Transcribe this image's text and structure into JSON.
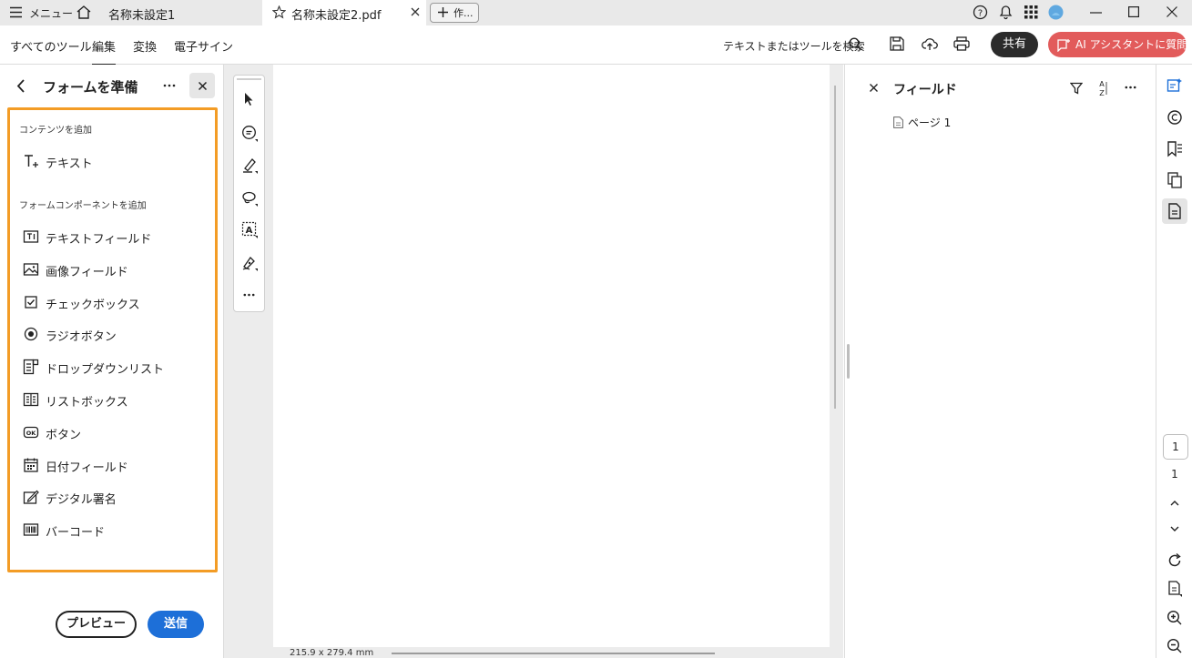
{
  "titlebar": {
    "menu_label": "メニュー",
    "tab1_label": "名称未設定1",
    "tab2_label": "名称未設定2.pdf",
    "new_tab_label": "作..."
  },
  "toolbar": {
    "menu": [
      "すべてのツール",
      "編集",
      "変換",
      "電子サイン"
    ],
    "active_menu": "編集",
    "search_label": "テキストまたはツールを検索",
    "share_label": "共有",
    "ai_label": "AI アシスタントに質問"
  },
  "left_panel": {
    "title": "フォームを準備",
    "section1": "コンテンツを追加",
    "section1_items": [
      {
        "label": "テキスト",
        "icon": "add-text-icon"
      }
    ],
    "section2": "フォームコンポーネントを追加",
    "section2_items": [
      {
        "label": "テキストフィールド",
        "icon": "text-field-icon"
      },
      {
        "label": "画像フィールド",
        "icon": "image-field-icon"
      },
      {
        "label": "チェックボックス",
        "icon": "checkbox-icon"
      },
      {
        "label": "ラジオボタン",
        "icon": "radio-button-icon"
      },
      {
        "label": "ドロップダウンリスト",
        "icon": "dropdown-list-icon"
      },
      {
        "label": "リストボックス",
        "icon": "list-box-icon"
      },
      {
        "label": "ボタン",
        "icon": "ok-button-icon"
      },
      {
        "label": "日付フィールド",
        "icon": "date-field-icon"
      },
      {
        "label": "デジタル署名",
        "icon": "digital-signature-icon"
      },
      {
        "label": "バーコード",
        "icon": "barcode-icon"
      }
    ],
    "preview_label": "プレビュー",
    "send_label": "送信"
  },
  "canvas": {
    "page_size": "215.9 x 279.4 mm"
  },
  "right_panel": {
    "title": "フィールド",
    "page_item": "ページ 1"
  },
  "rail": {
    "current_page": "1",
    "total_pages": "1"
  },
  "colors": {
    "accent_orange": "#f39c25",
    "send_blue": "#1d6fd8",
    "ai_red": "#e25b5b"
  }
}
